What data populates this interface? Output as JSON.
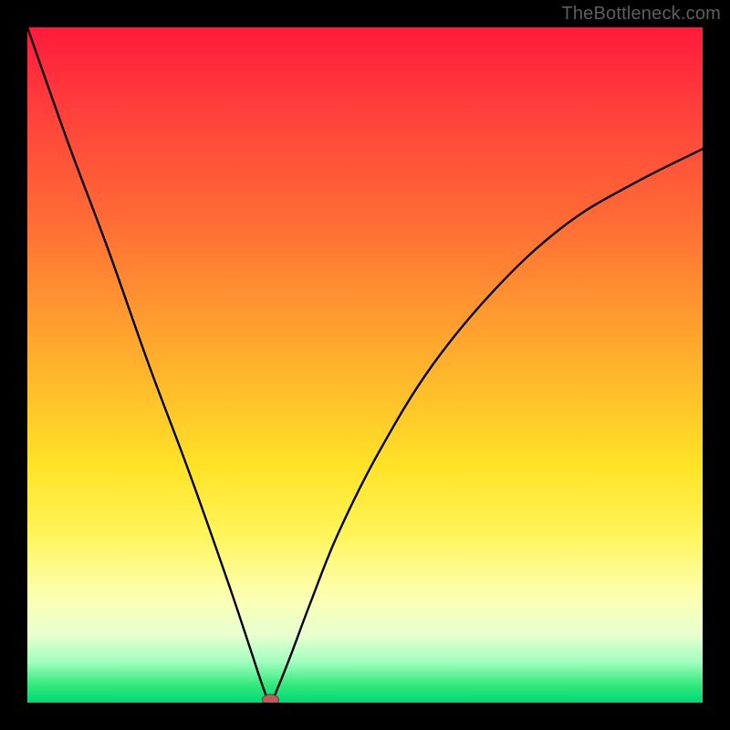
{
  "watermark": "TheBottleneck.com",
  "chart_data": {
    "type": "line",
    "title": "",
    "xlabel": "",
    "ylabel": "",
    "xlim": [
      0,
      100
    ],
    "ylim": [
      0,
      100
    ],
    "grid": false,
    "legend": false,
    "notes": "V-shaped bottleneck curve over red→green vertical gradient; minimum near x≈36, y≈0; left arm near-linear to top-left, right arm concave rising toward upper-right. Small red marker at curve minimum.",
    "series": [
      {
        "name": "bottleneck-curve",
        "x": [
          0,
          6,
          12,
          18,
          24,
          30,
          33,
          35,
          36,
          37,
          39,
          42,
          46,
          52,
          60,
          70,
          80,
          90,
          100
        ],
        "y": [
          100,
          83,
          67,
          50,
          34,
          17,
          8,
          2,
          0,
          2,
          7,
          15,
          25,
          37,
          50,
          62,
          71,
          77,
          82
        ]
      }
    ],
    "marker": {
      "x": 36,
      "y": 0,
      "color": "#c05a5a"
    },
    "gradient_stops": [
      {
        "pos": 0,
        "color": "#ff1a3c"
      },
      {
        "pos": 0.12,
        "color": "#ff3f3c"
      },
      {
        "pos": 0.28,
        "color": "#ff6a35"
      },
      {
        "pos": 0.42,
        "color": "#ff9830"
      },
      {
        "pos": 0.55,
        "color": "#ffc22a"
      },
      {
        "pos": 0.65,
        "color": "#ffe327"
      },
      {
        "pos": 0.75,
        "color": "#fff45a"
      },
      {
        "pos": 0.84,
        "color": "#fdffb0"
      },
      {
        "pos": 0.9,
        "color": "#e8ffd0"
      },
      {
        "pos": 0.94,
        "color": "#9fffbe"
      },
      {
        "pos": 0.975,
        "color": "#30e87a"
      },
      {
        "pos": 1.0,
        "color": "#00d878"
      }
    ]
  }
}
